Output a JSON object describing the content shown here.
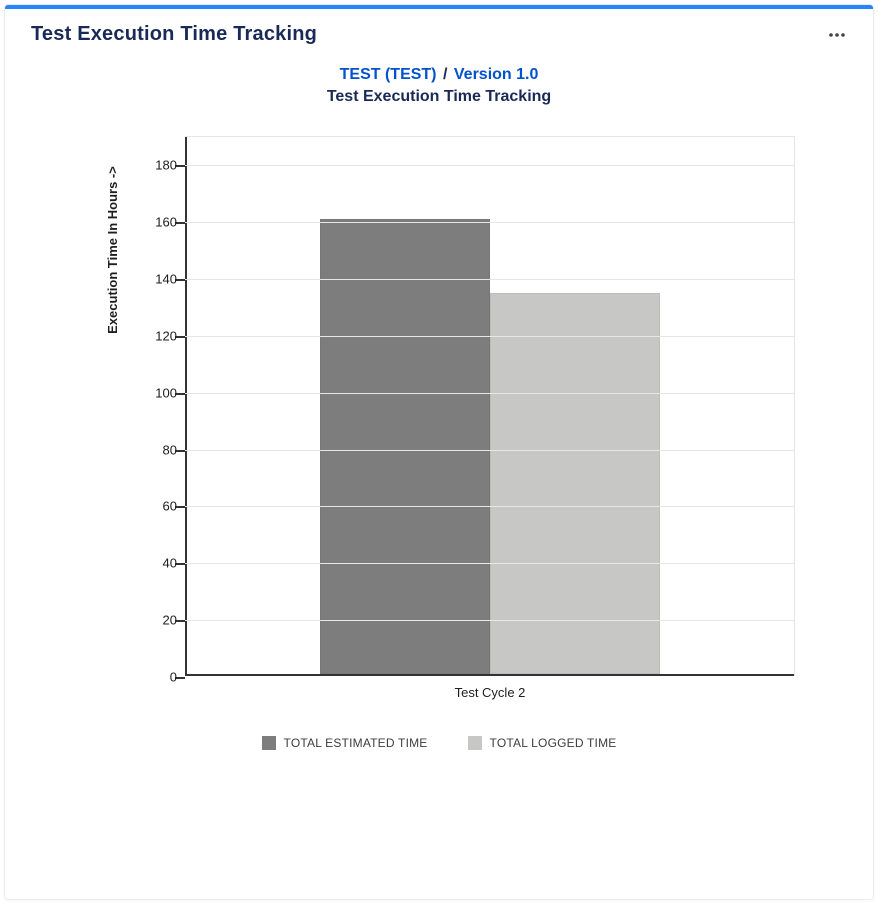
{
  "card": {
    "title": "Test Execution Time Tracking",
    "project_link": "TEST (TEST)",
    "separator": "/",
    "version_link": "Version 1.0",
    "subtitle": "Test Execution Time Tracking"
  },
  "chart_data": {
    "type": "bar",
    "categories": [
      "Test Cycle 2"
    ],
    "series": [
      {
        "name": "TOTAL ESTIMATED TIME",
        "values": [
          160
        ],
        "color": "#7d7d7d"
      },
      {
        "name": "TOTAL LOGGED TIME",
        "values": [
          134
        ],
        "color": "#c7c7c6"
      }
    ],
    "ylabel": "Execution Time In Hours ->",
    "xlabel": "",
    "title": "",
    "ylim": [
      0,
      190
    ],
    "yticks": [
      0,
      20,
      40,
      60,
      80,
      100,
      120,
      140,
      160,
      180
    ]
  }
}
